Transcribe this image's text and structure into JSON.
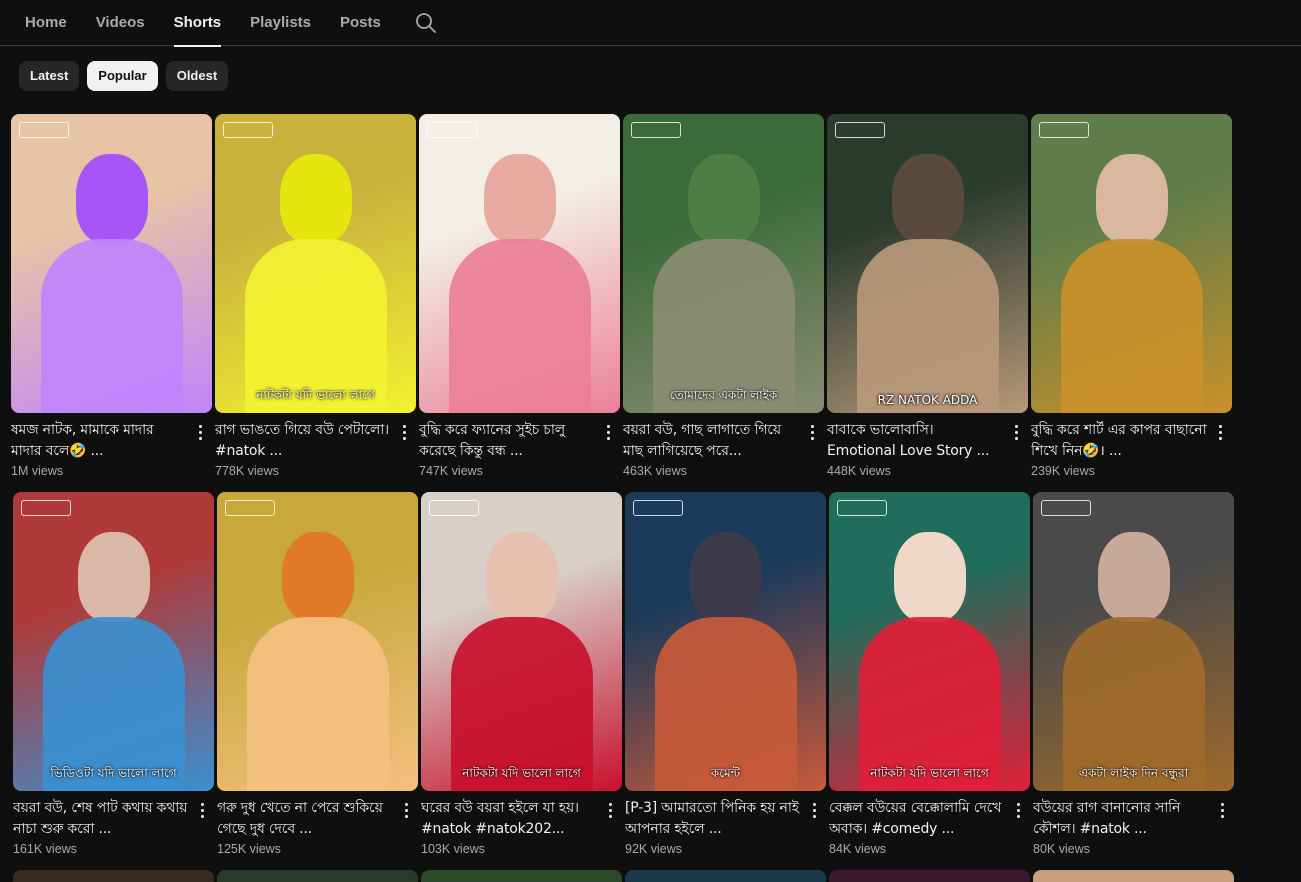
{
  "tabs": [
    {
      "label": "Home",
      "active": false
    },
    {
      "label": "Videos",
      "active": false
    },
    {
      "label": "Shorts",
      "active": true
    },
    {
      "label": "Playlists",
      "active": false
    },
    {
      "label": "Posts",
      "active": false
    }
  ],
  "search_icon": "search-icon",
  "chips": [
    {
      "label": "Latest",
      "selected": false
    },
    {
      "label": "Popular",
      "selected": true
    },
    {
      "label": "Oldest",
      "selected": false
    }
  ],
  "shorts": [
    {
      "title": "ষমজ নাটক, মামাকে মাদার মাদার বলে🤣 ...",
      "views": "1M views",
      "overlay": "",
      "colors": [
        "#e8c4a6",
        "#a855f7",
        "#c084fc"
      ]
    },
    {
      "title": "রাগ ভাঙতে গিয়ে বউ পেটালো। #natok ...",
      "views": "778K views",
      "overlay": "নাটকটা যদি ভালো লাগে",
      "colors": [
        "#c9b23c",
        "#e5e510",
        "#f2f230"
      ]
    },
    {
      "title": "বুদ্ধি করে ফ্যানের সুইচ চালু করেছে কিন্তু বন্ধ ...",
      "views": "747K views",
      "overlay": "",
      "colors": [
        "#f3efe6",
        "#e8a9a0",
        "#ec7f9a"
      ]
    },
    {
      "title": "বয়রা বউ, গাছ লাগাতে গিয়ে মাছ লাগিয়েছে পরে...",
      "views": "463K views",
      "overlay": "তোমাদের একটা লাইক",
      "colors": [
        "#3b6b3b",
        "#4f7d46",
        "#8a8c72"
      ]
    },
    {
      "title": "বাবাকে ভালোবাসি। Emotional Love Story ...",
      "views": "448K views",
      "overlay": "RZ NATOK ADDA",
      "colors": [
        "#2b3b2e",
        "#5a4a3c",
        "#b8987a"
      ]
    },
    {
      "title": "বুদ্ধি করে শার্ট এর কাপর বাছানো শিখে নিন🤣। ...",
      "views": "239K views",
      "overlay": "",
      "colors": [
        "#5f7d4a",
        "#d9b7a0",
        "#c9902a"
      ]
    },
    {
      "title": "বয়রা বউ, শেষ পাট কথায় কথায় নাচা শুরু করো ...",
      "views": "161K views",
      "overlay": "ভিডিওটা যদি ভালো লাগে",
      "colors": [
        "#b03a3a",
        "#d9b8a8",
        "#3b8fd0"
      ]
    },
    {
      "title": "গরু দুধ খেতে না পেরে শুকিয়ে গেছে দুধ দেবে ...",
      "views": "125K views",
      "overlay": "",
      "colors": [
        "#c8a83a",
        "#e07a28",
        "#f4c080"
      ]
    },
    {
      "title": "ঘরের বউ বয়রা হইলে যা হয়। #natok #natok202...",
      "views": "103K views",
      "overlay": "নাটকটা যদি ভালো লাগে",
      "colors": [
        "#d8d0c8",
        "#e8c0b0",
        "#c8102e"
      ]
    },
    {
      "title": "[P-3] আমারতো পিনিক হয় নাই আপনার হইলে ...",
      "views": "92K views",
      "overlay": "কমেন্ট",
      "colors": [
        "#1c3a5a",
        "#3a3a4a",
        "#c85a3a"
      ]
    },
    {
      "title": "বেক্কল বউয়ের বেক্কোলামি দেখে অবাক। #comedy ...",
      "views": "84K views",
      "overlay": "নাটকটা যদি ভালো লাগে",
      "colors": [
        "#1f6d5a",
        "#f0d8c8",
        "#e0203a"
      ]
    },
    {
      "title": "বউয়ের রাগ বানানোর সানি কৌশল। #natok ...",
      "views": "80K views",
      "overlay": "একটা লাইক দিন বন্ধুরা",
      "colors": [
        "#4a4a4a",
        "#c8a898",
        "#a06a2a"
      ]
    }
  ],
  "peek_colors": [
    "#3a2a20",
    "#2a3a2a",
    "#2a4a2a",
    "#1a3a4a",
    "#3a1a2a",
    "#c8a080"
  ]
}
